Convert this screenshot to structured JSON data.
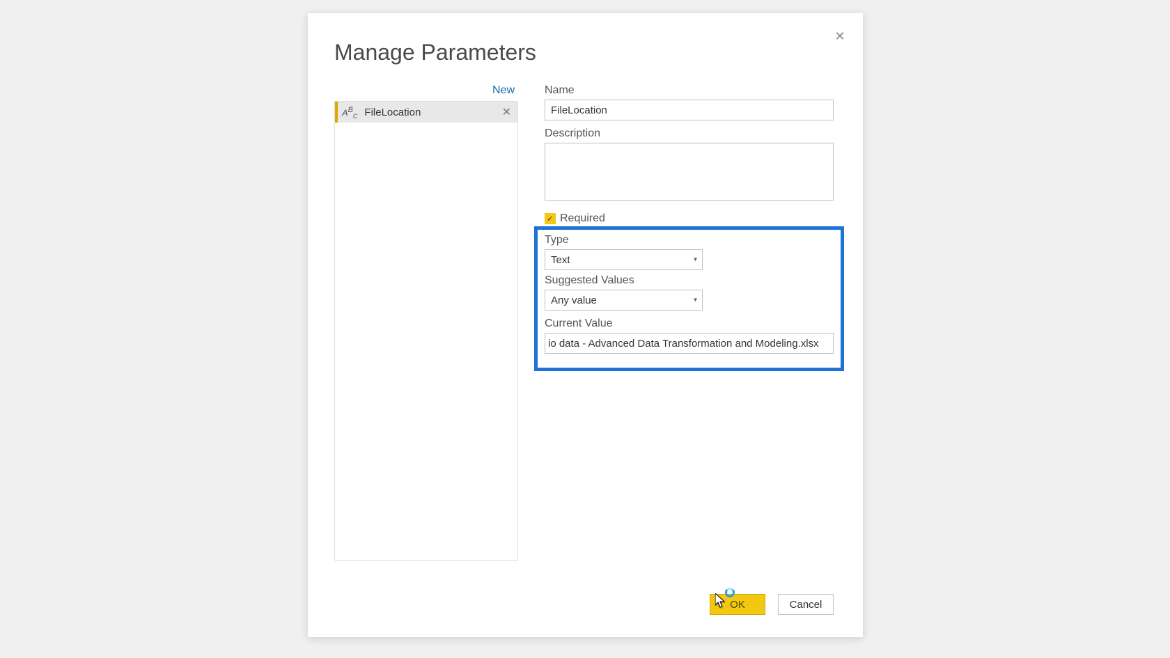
{
  "dialog": {
    "title": "Manage Parameters"
  },
  "leftPanel": {
    "newLink": "New",
    "parameters": [
      {
        "name": "FileLocation"
      }
    ]
  },
  "form": {
    "nameLabel": "Name",
    "nameValue": "FileLocation",
    "descriptionLabel": "Description",
    "descriptionValue": "",
    "requiredLabel": "Required",
    "requiredChecked": true,
    "typeLabel": "Type",
    "typeValue": "Text",
    "suggestedLabel": "Suggested Values",
    "suggestedValue": "Any value",
    "currentValueLabel": "Current Value",
    "currentValueValue": "io data - Advanced Data Transformation and Modeling.xlsx"
  },
  "buttons": {
    "ok": "OK",
    "cancel": "Cancel"
  }
}
